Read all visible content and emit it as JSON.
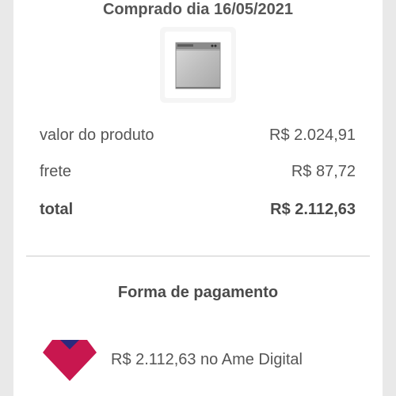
{
  "order": {
    "purchased_label": "Comprado dia 16/05/2021",
    "product_image": "dishwasher-product-image"
  },
  "summary": {
    "rows": [
      {
        "label": "valor do produto",
        "value": "R$ 2.024,91"
      },
      {
        "label": "frete",
        "value": "R$ 87,72"
      },
      {
        "label": "total",
        "value": "R$ 2.112,63"
      }
    ]
  },
  "payment": {
    "title": "Forma de pagamento",
    "method_text": "R$ 2.112,63 no Ame Digital",
    "icon": "ame-digital-logo-icon",
    "colors": {
      "ame_magenta": "#c8174f",
      "ame_navy": "#2b2a7d"
    }
  }
}
